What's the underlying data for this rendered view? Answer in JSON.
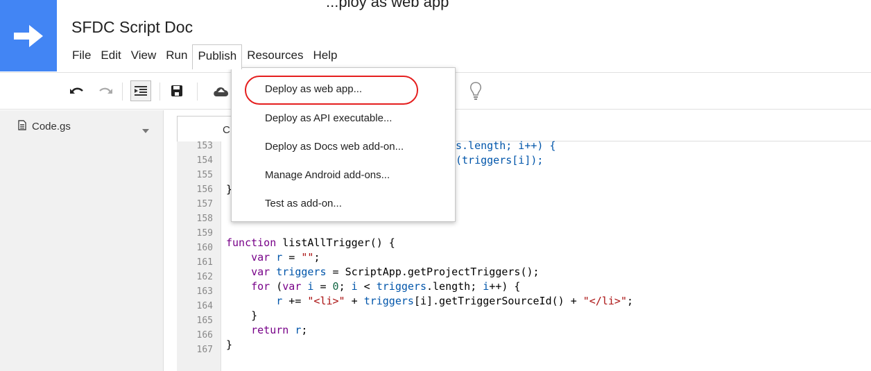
{
  "top_caption": "...ploy as web app",
  "app": {
    "title": "SFDC Script Doc",
    "logo_icon": "arrow-right-icon",
    "accent_color": "#4285f4"
  },
  "menubar": {
    "items": [
      "File",
      "Edit",
      "View",
      "Run",
      "Publish",
      "Resources",
      "Help"
    ],
    "active": "Publish"
  },
  "toolbar": {
    "icons": [
      "undo-icon",
      "redo-icon",
      "indent-icon",
      "save-icon",
      "cloud-upload-icon",
      "lightbulb-icon"
    ]
  },
  "sidebar": {
    "files": [
      {
        "name": "Code.gs",
        "icon": "document-icon"
      }
    ]
  },
  "editor": {
    "tab_label": "C",
    "line_numbers": [
      "153",
      "154",
      "155",
      "156",
      "157",
      "158",
      "159",
      "160",
      "161",
      "162",
      "163",
      "164",
      "165",
      "166",
      "167"
    ],
    "visible_fragments": {
      "l153": "s.length; i++) {",
      "l154": "(triggers[i]);",
      "l156": "}"
    },
    "code": {
      "l159_kw": "function",
      "l159_rest": " listAllTrigger() {",
      "l160_kw": "var",
      "l160_var": "r",
      "l160_eq": " = ",
      "l160_str": "\"\"",
      "l160_end": ";",
      "l161_kw": "var",
      "l161_var": "triggers",
      "l161_rest": " = ScriptApp.getProjectTriggers();",
      "l162_kw1": "for",
      "l162_p1": " (",
      "l162_kw2": "var",
      "l162_var": "i",
      "l162_eq": " = ",
      "l162_num": "0",
      "l162_p2": "; ",
      "l162_var2": "i",
      "l162_p3": " < ",
      "l162_var3": "triggers",
      "l162_rest": ".length; ",
      "l162_var4": "i",
      "l162_end": "++) {",
      "l163_var": "r",
      "l163_op": " += ",
      "l163_s1": "\"<li>\"",
      "l163_p": " + ",
      "l163_var2": "triggers",
      "l163_mid": "[i].getTriggerSourceId() + ",
      "l163_s2": "\"</li>\"",
      "l163_end": ";",
      "l164": "}",
      "l165_kw": "return",
      "l165_var": "r",
      "l165_end": ";",
      "l166": "}"
    }
  },
  "publish_menu": {
    "items": [
      "Deploy as web app...",
      "Deploy as API executable...",
      "Deploy as Docs web add-on...",
      "Manage Android add-ons...",
      "Test as add-on..."
    ],
    "highlighted": "Deploy as web app...",
    "highlight_color": "#e51e1e"
  }
}
